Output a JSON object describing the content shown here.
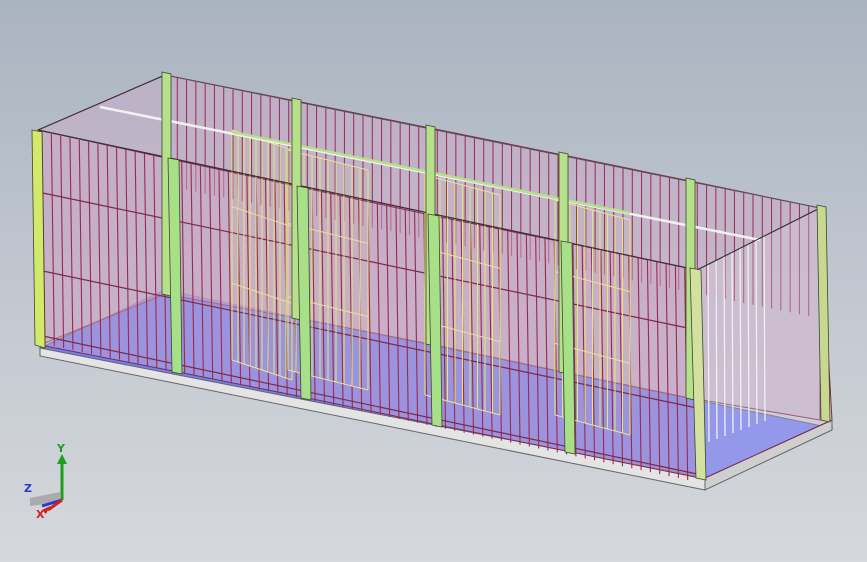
{
  "viewport": {
    "background_top": "#aab3c0",
    "background_bottom": "#d5d8dc"
  },
  "model": {
    "frame_color": "#b6e08a",
    "mesh_color": "#9a2a4a",
    "panel_fill": "#c9a8c8",
    "floor_color": "#6f7ff5",
    "gate_color": "#e8e0a0",
    "rail_color": "#e3ea6a",
    "rod_color": "#f0f0f0"
  },
  "triad": {
    "y_label": "Y",
    "z_label": "Z",
    "x_label": "X",
    "y_color": "#1aa01a",
    "z_color": "#2a3ad0",
    "x_color": "#d02020"
  }
}
